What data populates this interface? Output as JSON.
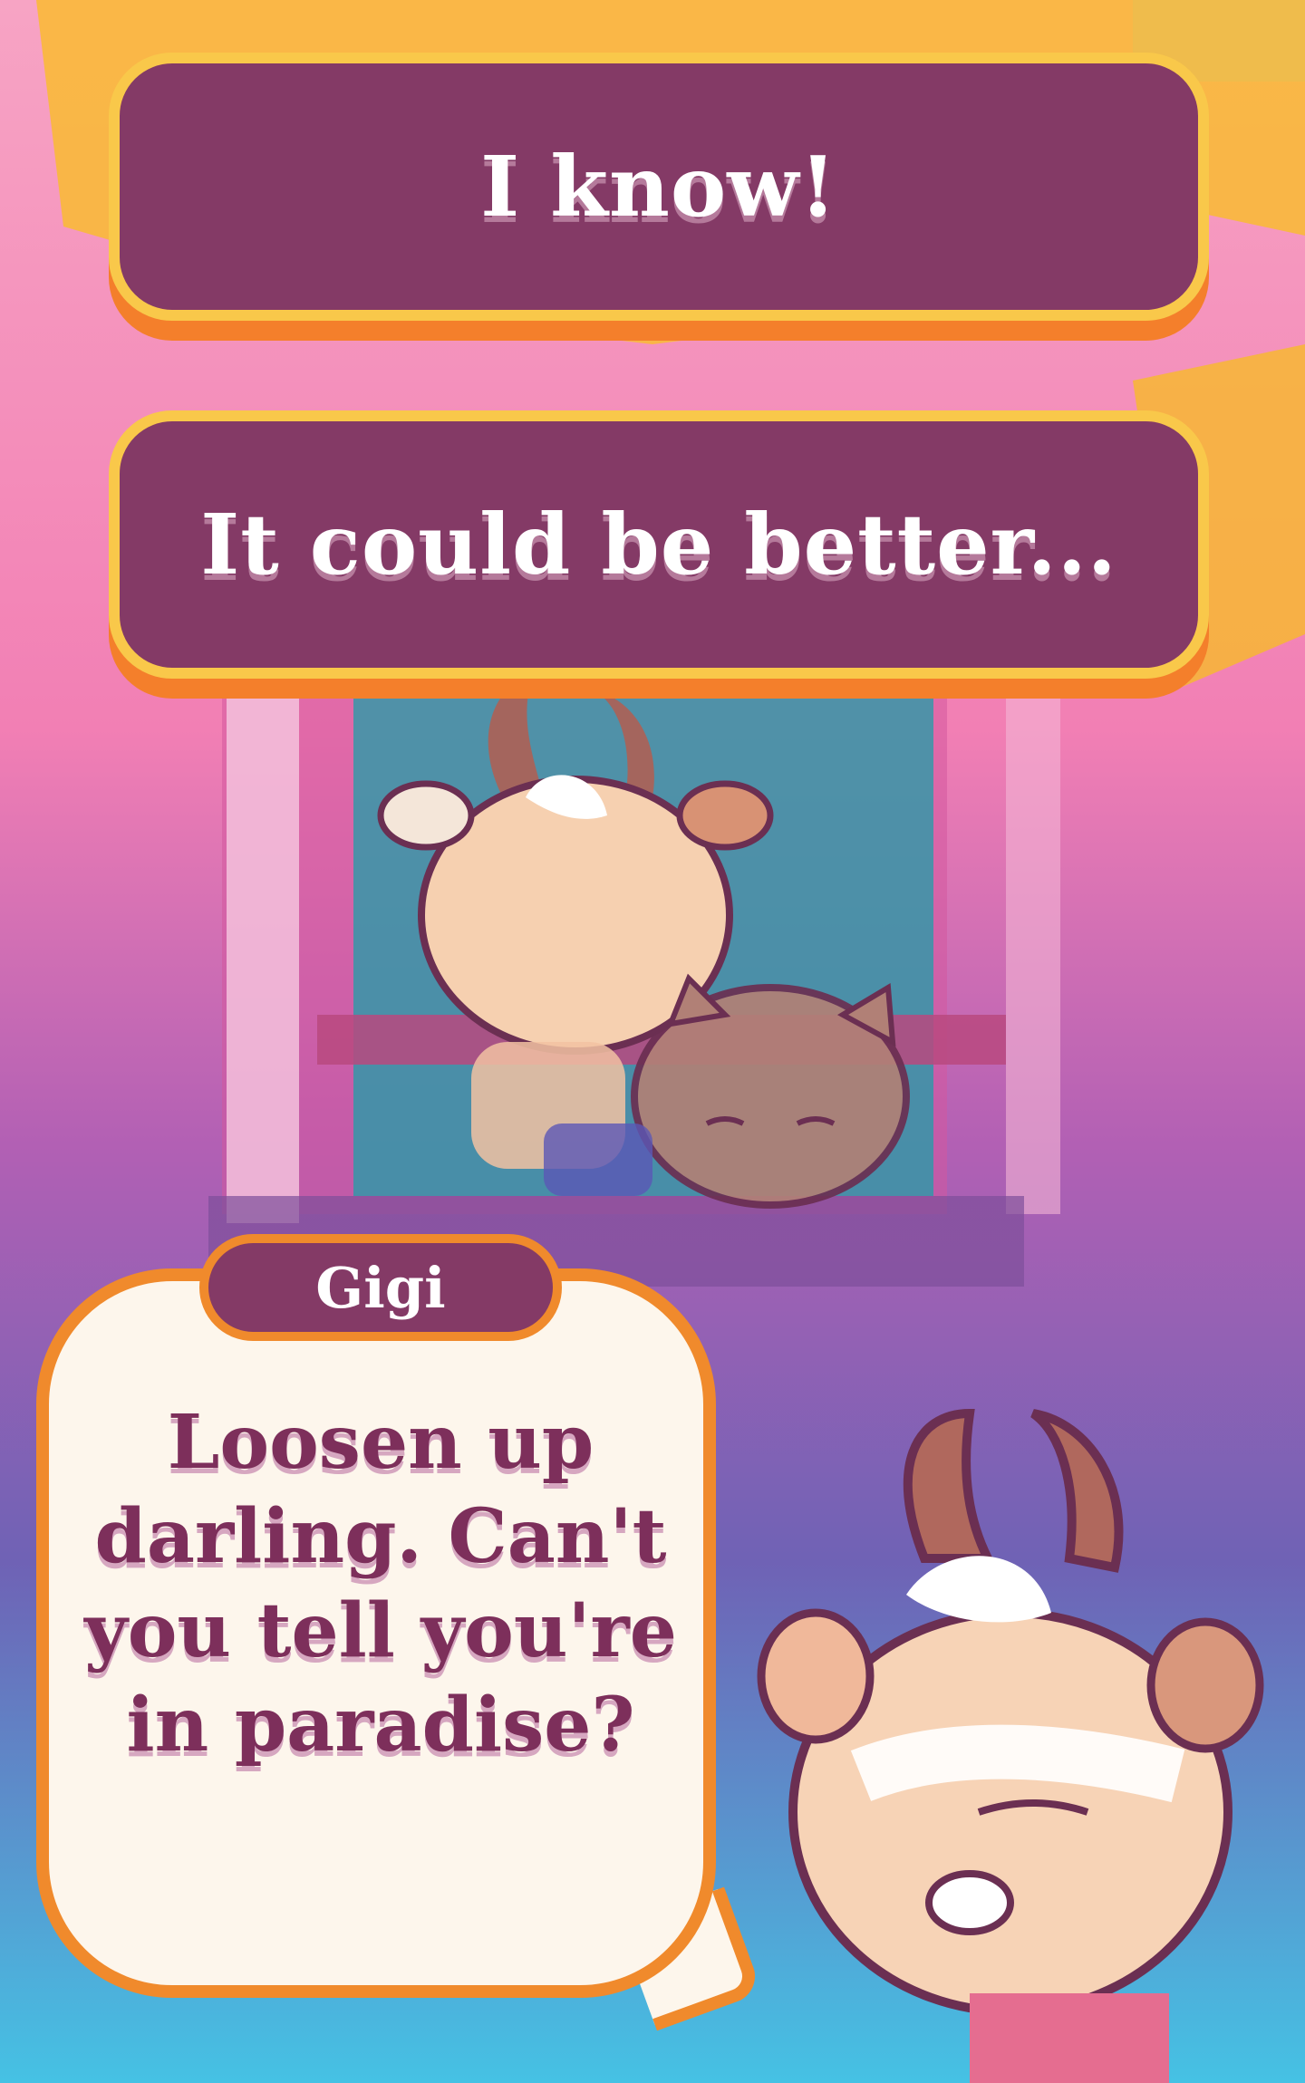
{
  "choices": [
    {
      "label": "I know!"
    },
    {
      "label": "It could be better..."
    }
  ],
  "dialog": {
    "speaker": "Gigi",
    "text": "Loosen up darling. Can't you tell you're in paradise?"
  },
  "colors": {
    "panel": "#843a66",
    "panel_border": "#f9c84a",
    "panel_shadow": "#f47f2b",
    "bubble": "#fdf6ec",
    "bubble_border": "#f08a2c",
    "dialog_text": "#7d2f5b"
  }
}
